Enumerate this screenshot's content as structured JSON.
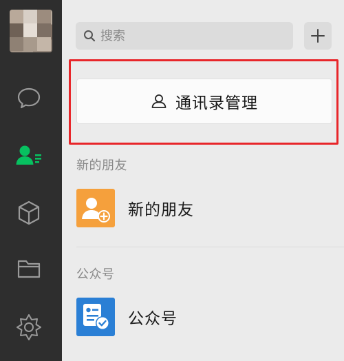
{
  "search": {
    "placeholder": "搜索"
  },
  "header": {
    "add_button_symbol": "+"
  },
  "manage_button": {
    "label": "通讯录管理"
  },
  "sections": [
    {
      "label": "新的朋友",
      "items": [
        {
          "name": "新的朋友",
          "icon": "new-friend-icon",
          "color": "#f5a03c"
        }
      ]
    },
    {
      "label": "公众号",
      "items": [
        {
          "name": "公众号",
          "icon": "official-account-icon",
          "color": "#2a7fd5"
        }
      ]
    }
  ],
  "sidebar": {
    "items": [
      {
        "icon": "chat-icon",
        "active": false
      },
      {
        "icon": "contacts-icon",
        "active": true
      },
      {
        "icon": "cube-icon",
        "active": false
      },
      {
        "icon": "folder-icon",
        "active": false
      },
      {
        "icon": "mini-program-icon",
        "active": false
      }
    ],
    "accent": "#07c160"
  }
}
